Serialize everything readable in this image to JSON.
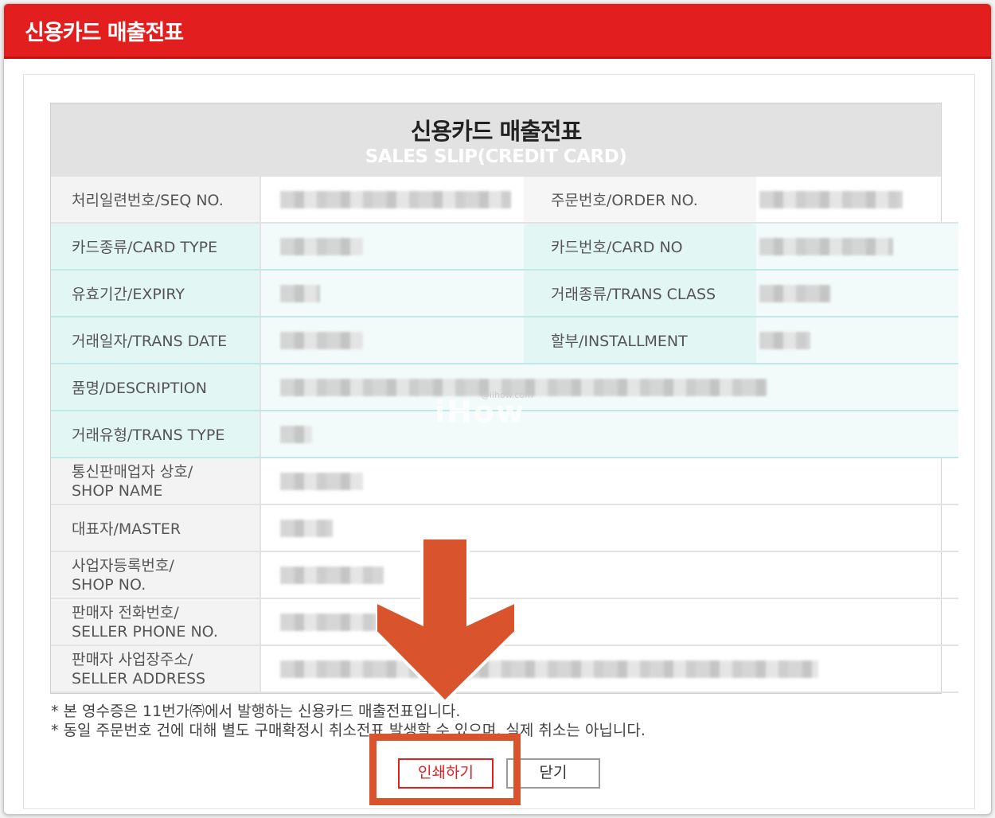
{
  "window": {
    "title": "신용카드 매출전표"
  },
  "slip": {
    "title_ko": "신용카드 매출전표",
    "title_en": "SALES SLIP(CREDIT CARD)",
    "rows": [
      {
        "label": "처리일련번호/SEQ NO.",
        "label2": "주문번호/ORDER NO."
      },
      {
        "label": "카드종류/CARD TYPE",
        "label2": "카드번호/CARD NO"
      },
      {
        "label": "유효기간/EXPIRY",
        "label2": "거래종류/TRANS CLASS"
      },
      {
        "label": "거래일자/TRANS DATE",
        "label2": "할부/INSTALLMENT"
      },
      {
        "label": "품명/DESCRIPTION"
      },
      {
        "label": "거래유형/TRANS TYPE"
      },
      {
        "label_l1": "통신판매업자 상호/",
        "label_l2": "SHOP NAME"
      },
      {
        "label": "대표자/MASTER"
      },
      {
        "label_l1": "사업자등록번호/",
        "label_l2": "SHOP NO."
      },
      {
        "label_l1": "판매자 전화번호/",
        "label_l2": "SELLER PHONE NO."
      },
      {
        "label_l1": "판매자 사업장주소/",
        "label_l2": "SELLER ADDRESS"
      }
    ]
  },
  "notes": [
    "* 본 영수증은 11번가㈜에서 발행하는 신용카드 매출전표입니다.",
    "* 동일 주문번호 건에 대해 별도 구매확정시 취소전표 발생할 수 있으며, 실제 취소는 아닙니다."
  ],
  "buttons": {
    "print": "인쇄하기",
    "close": "닫기"
  },
  "watermark": {
    "main": "iHow",
    "small": "@iihow.com"
  },
  "colors": {
    "brand_red": "#e21e1e",
    "annotation_orange": "#d9532d",
    "row_highlight": "#e2f6f3"
  },
  "icons": {
    "annotation": "down-arrow-icon"
  }
}
